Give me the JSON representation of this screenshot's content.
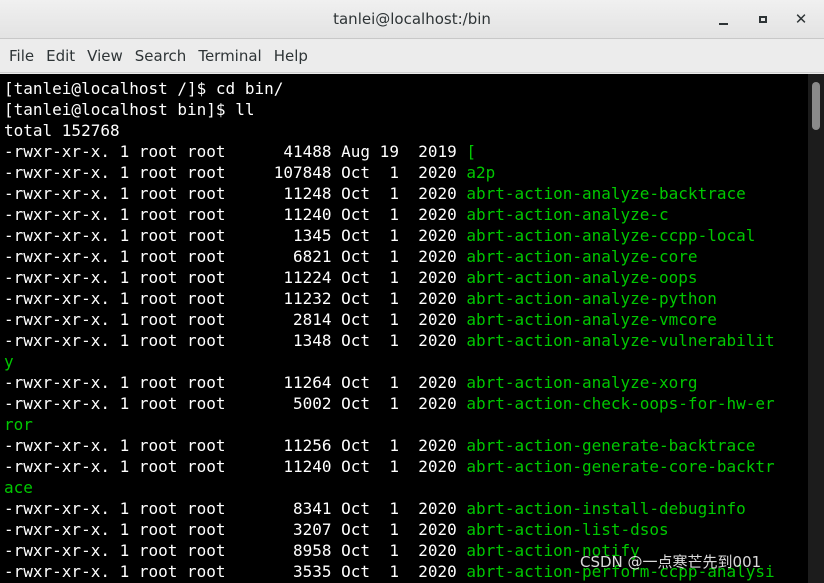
{
  "window": {
    "title": "tanlei@localhost:/bin",
    "buttons": {
      "minimize_icon": "minimize-icon",
      "maximize_icon": "maximize-icon",
      "close_icon": "close-icon"
    }
  },
  "menu": [
    "File",
    "Edit",
    "View",
    "Search",
    "Terminal",
    "Help"
  ],
  "colors": {
    "terminal_bg": "#000000",
    "text": "#ffffff",
    "executable": "#00c800"
  },
  "terminal": {
    "lines": [
      {
        "text": "[tanlei@localhost /]$ cd bin/",
        "file": ""
      },
      {
        "text": "[tanlei@localhost bin]$ ll",
        "file": ""
      },
      {
        "text": "total 152768",
        "file": ""
      },
      {
        "text": "-rwxr-xr-x. 1 root root      41488 Aug 19  2019 ",
        "file": "["
      },
      {
        "text": "-rwxr-xr-x. 1 root root     107848 Oct  1  2020 ",
        "file": "a2p"
      },
      {
        "text": "-rwxr-xr-x. 1 root root      11248 Oct  1  2020 ",
        "file": "abrt-action-analyze-backtrace"
      },
      {
        "text": "-rwxr-xr-x. 1 root root      11240 Oct  1  2020 ",
        "file": "abrt-action-analyze-c"
      },
      {
        "text": "-rwxr-xr-x. 1 root root       1345 Oct  1  2020 ",
        "file": "abrt-action-analyze-ccpp-local"
      },
      {
        "text": "-rwxr-xr-x. 1 root root       6821 Oct  1  2020 ",
        "file": "abrt-action-analyze-core"
      },
      {
        "text": "-rwxr-xr-x. 1 root root      11224 Oct  1  2020 ",
        "file": "abrt-action-analyze-oops"
      },
      {
        "text": "-rwxr-xr-x. 1 root root      11232 Oct  1  2020 ",
        "file": "abrt-action-analyze-python"
      },
      {
        "text": "-rwxr-xr-x. 1 root root       2814 Oct  1  2020 ",
        "file": "abrt-action-analyze-vmcore"
      },
      {
        "text": "-rwxr-xr-x. 1 root root       1348 Oct  1  2020 ",
        "file": "abrt-action-analyze-vulnerabilit"
      },
      {
        "text": "",
        "file": "y"
      },
      {
        "text": "-rwxr-xr-x. 1 root root      11264 Oct  1  2020 ",
        "file": "abrt-action-analyze-xorg"
      },
      {
        "text": "-rwxr-xr-x. 1 root root       5002 Oct  1  2020 ",
        "file": "abrt-action-check-oops-for-hw-er"
      },
      {
        "text": "",
        "file": "ror"
      },
      {
        "text": "-rwxr-xr-x. 1 root root      11256 Oct  1  2020 ",
        "file": "abrt-action-generate-backtrace"
      },
      {
        "text": "-rwxr-xr-x. 1 root root      11240 Oct  1  2020 ",
        "file": "abrt-action-generate-core-backtr"
      },
      {
        "text": "",
        "file": "ace"
      },
      {
        "text": "-rwxr-xr-x. 1 root root       8341 Oct  1  2020 ",
        "file": "abrt-action-install-debuginfo"
      },
      {
        "text": "-rwxr-xr-x. 1 root root       3207 Oct  1  2020 ",
        "file": "abrt-action-list-dsos"
      },
      {
        "text": "-rwxr-xr-x. 1 root root       8958 Oct  1  2020 ",
        "file": "abrt-action-notify"
      },
      {
        "text": "-rwxr-xr-x. 1 root root       3535 Oct  1  2020 ",
        "file": "abrt-action-perform-ccpp-analysi"
      }
    ]
  },
  "watermark": "CSDN @一点寒芒先到001"
}
